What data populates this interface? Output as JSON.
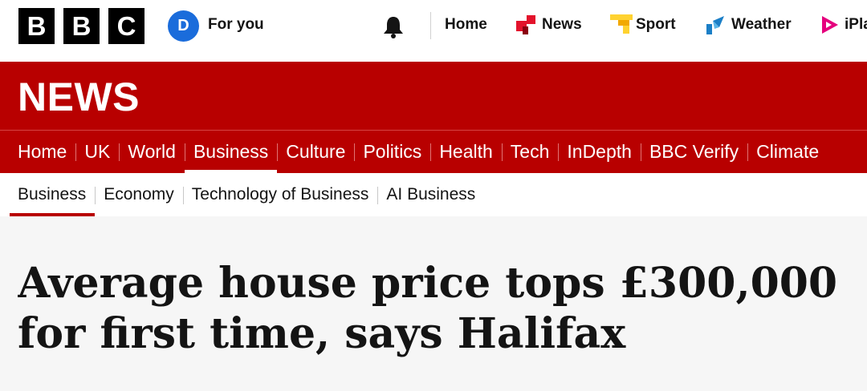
{
  "global": {
    "logo_letters": [
      "B",
      "B",
      "C"
    ],
    "account_initial": "D",
    "for_you_label": "For you",
    "nav": [
      {
        "label": "Home",
        "icon": "none"
      },
      {
        "label": "News",
        "icon": "news-icon"
      },
      {
        "label": "Sport",
        "icon": "sport-icon"
      },
      {
        "label": "Weather",
        "icon": "weather-icon"
      },
      {
        "label": "iPla",
        "icon": "iplayer-icon"
      }
    ]
  },
  "news": {
    "logo": "NEWS",
    "primary_nav": [
      "Home",
      "UK",
      "World",
      "Business",
      "Culture",
      "Politics",
      "Health",
      "Tech",
      "InDepth",
      "BBC Verify",
      "Climate"
    ],
    "primary_active": "Business",
    "secondary_nav": [
      "Business",
      "Economy",
      "Technology of Business",
      "AI Business"
    ],
    "secondary_active": "Business"
  },
  "article": {
    "headline_line1": "Average house price tops £300,000",
    "headline_line2": "for first time, says Halifax"
  },
  "colors": {
    "news_red": "#b80000",
    "avatar_blue": "#1a6cdb",
    "sport_yellow": "#ffd230",
    "weather_blue": "#1b7fc7",
    "iplayer_pink": "#e5007d"
  }
}
